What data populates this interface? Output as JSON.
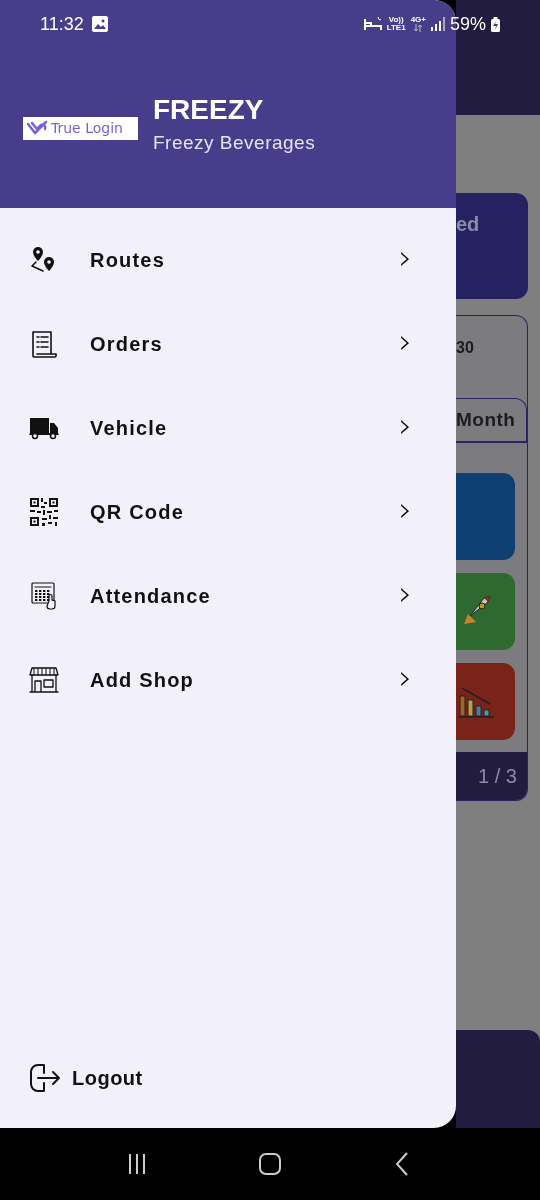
{
  "status_bar": {
    "time": "11:32",
    "volte": "Vo))",
    "lte": "LTE1",
    "network": "4G+",
    "battery": "59%"
  },
  "drawer": {
    "logo_text": "True Login",
    "title": "FREEZY",
    "subtitle": "Freezy Beverages",
    "menu": [
      {
        "label": "Routes",
        "chevron": "›"
      },
      {
        "label": "Orders",
        "chevron": "›"
      },
      {
        "label": "Vehicle",
        "chevron": "›"
      },
      {
        "label": "QR Code",
        "chevron": "›"
      },
      {
        "label": "Attendance",
        "chevron": "›"
      },
      {
        "label": "Add Shop",
        "chevron": "›"
      }
    ],
    "logout": "Logout"
  },
  "background_app": {
    "card_text": "ed",
    "count_text": "30",
    "tab": "Month",
    "pager": "1 / 3"
  }
}
